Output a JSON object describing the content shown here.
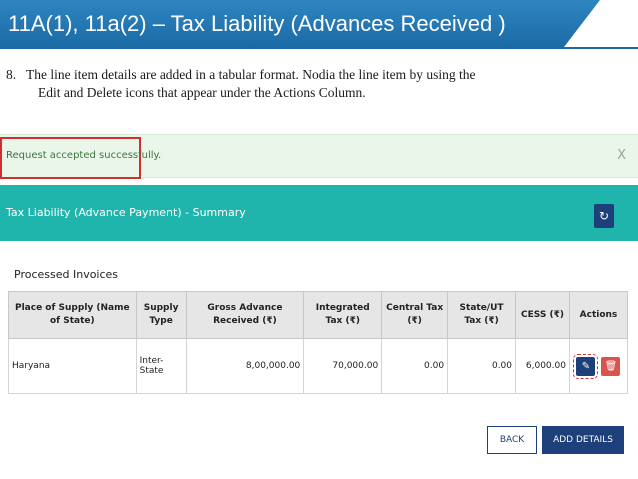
{
  "slide": {
    "title": "11A(1), 11a(2) – Tax Liability (Advances Received )",
    "step_number": "8.",
    "step_line1": "The line item details are added in a tabular format. Nodia the line item by using the",
    "step_line2": "Edit and Delete icons that appear under the Actions Column."
  },
  "alert": {
    "message": "Request accepted successfully.",
    "close_glyph": "X"
  },
  "panel": {
    "title": "Tax Liability (Advance Payment) - Summary",
    "refresh_glyph": "↻"
  },
  "section": {
    "title": "Processed Invoices"
  },
  "table": {
    "headers": [
      "Place of Supply (Name of State)",
      "Supply Type",
      "Gross Advance Received (₹)",
      "Integrated Tax (₹)",
      "Central Tax (₹)",
      "State/UT Tax (₹)",
      "CESS (₹)",
      "Actions"
    ],
    "rows": [
      {
        "place": "Haryana",
        "supply_type": "Inter-State",
        "gross_advance": "8,00,000.00",
        "integrated_tax": "70,000.00",
        "central_tax": "0.00",
        "state_tax": "0.00",
        "cess": "6,000.00",
        "edit_glyph": "✎",
        "delete_glyph": "🗑"
      }
    ]
  },
  "buttons": {
    "back": "BACK",
    "add_details": "ADD DETAILS"
  },
  "colors": {
    "banner": "#1b6aa5",
    "panel_header": "#1fb5ac",
    "primary_button": "#1d3f7a",
    "delete_button": "#d9534f",
    "highlight": "#d23030"
  }
}
